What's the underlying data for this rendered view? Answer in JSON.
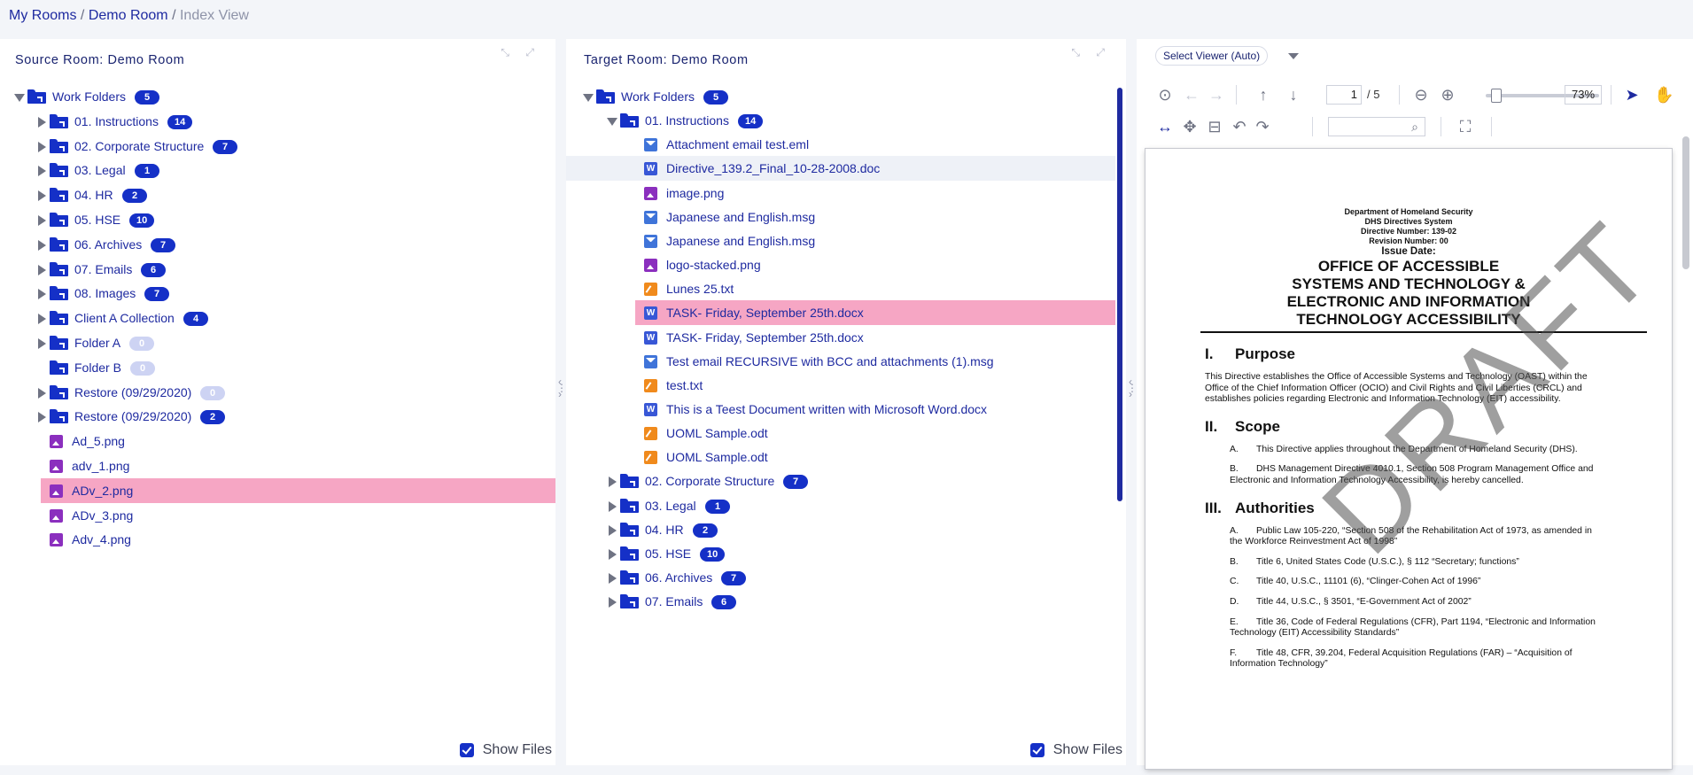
{
  "breadcrumb": {
    "root": "My Rooms",
    "sep1": "/",
    "room": "Demo Room",
    "sep2": "/",
    "current": "Index View"
  },
  "source": {
    "title": "Source Room: Demo Room",
    "show_files": "Show Files",
    "rows": [
      {
        "label": "Work Folders",
        "badge": "5",
        "kind": "folder",
        "toggle": "open"
      },
      {
        "label": "01. Instructions",
        "badge": "14",
        "kind": "folder",
        "toggle": "closed"
      },
      {
        "label": "02. Corporate Structure",
        "badge": "7",
        "kind": "folder",
        "toggle": "closed"
      },
      {
        "label": "03. Legal",
        "badge": "1",
        "kind": "folder",
        "toggle": "closed"
      },
      {
        "label": "04. HR",
        "badge": "2",
        "kind": "folder",
        "toggle": "closed"
      },
      {
        "label": "05. HSE",
        "badge": "10",
        "kind": "folder",
        "toggle": "closed"
      },
      {
        "label": "06. Archives",
        "badge": "7",
        "kind": "folder",
        "toggle": "closed"
      },
      {
        "label": "07. Emails",
        "badge": "6",
        "kind": "folder",
        "toggle": "closed"
      },
      {
        "label": "08. Images",
        "badge": "7",
        "kind": "folder",
        "toggle": "closed"
      },
      {
        "label": "Client A Collection",
        "badge": "4",
        "kind": "folder",
        "toggle": "closed"
      },
      {
        "label": "Folder A",
        "badge": "0",
        "kind": "folder",
        "toggle": "closed"
      },
      {
        "label": "Folder B",
        "badge": "0",
        "kind": "folder",
        "toggle": "none"
      },
      {
        "label": "Restore (09/29/2020)",
        "badge": "0",
        "kind": "folder",
        "toggle": "closed"
      },
      {
        "label": "Restore (09/29/2020)",
        "badge": "2",
        "kind": "folder",
        "toggle": "closed"
      },
      {
        "label": "Ad_5.png",
        "kind": "img"
      },
      {
        "label": "adv_1.png",
        "kind": "img"
      },
      {
        "label": "ADv_2.png",
        "kind": "img",
        "selected": true
      },
      {
        "label": "ADv_3.png",
        "kind": "img"
      },
      {
        "label": "Adv_4.png",
        "kind": "img"
      }
    ]
  },
  "target": {
    "title": "Target Room: Demo Room",
    "show_files": "Show Files",
    "rows": [
      {
        "label": "Work Folders",
        "badge": "5",
        "kind": "folder",
        "toggle": "open"
      },
      {
        "label": "01. Instructions",
        "badge": "14",
        "kind": "folder",
        "toggle": "open"
      },
      {
        "label": "Attachment email test.eml",
        "kind": "mail"
      },
      {
        "label": "Directive_139.2_Final_10-28-2008.doc",
        "kind": "doc",
        "hover": true
      },
      {
        "label": "image.png",
        "kind": "img"
      },
      {
        "label": "Japanese and English.msg",
        "kind": "mail"
      },
      {
        "label": "Japanese and English.msg",
        "kind": "mail"
      },
      {
        "label": "logo-stacked.png",
        "kind": "img"
      },
      {
        "label": "Lunes 25.txt",
        "kind": "txt"
      },
      {
        "label": "TASK- Friday, September 25th.docx",
        "kind": "doc",
        "selected": true
      },
      {
        "label": "TASK- Friday, September 25th.docx",
        "kind": "doc"
      },
      {
        "label": "Test email RECURSIVE with BCC and attachments (1).msg",
        "kind": "mail"
      },
      {
        "label": "test.txt",
        "kind": "txt"
      },
      {
        "label": "This is a Teest Document written with Microsoft Word.docx",
        "kind": "doc"
      },
      {
        "label": "UOML Sample.odt",
        "kind": "txt"
      },
      {
        "label": "UOML Sample.odt",
        "kind": "txt"
      },
      {
        "label": "02. Corporate Structure",
        "badge": "7",
        "kind": "folder",
        "toggle": "closed"
      },
      {
        "label": "03. Legal",
        "badge": "1",
        "kind": "folder",
        "toggle": "closed"
      },
      {
        "label": "04. HR",
        "badge": "2",
        "kind": "folder",
        "toggle": "closed"
      },
      {
        "label": "05. HSE",
        "badge": "10",
        "kind": "folder",
        "toggle": "closed"
      },
      {
        "label": "06. Archives",
        "badge": "7",
        "kind": "folder",
        "toggle": "closed"
      },
      {
        "label": "07. Emails",
        "badge": "6",
        "kind": "folder",
        "toggle": "closed"
      }
    ]
  },
  "viewer": {
    "select_label": "Select Viewer (Auto)",
    "page_current": "1",
    "page_total": "/ 5",
    "zoom": "73%",
    "zoom_slider_fraction": 0.05
  },
  "document": {
    "header": [
      "Department of Homeland Security",
      "DHS Directives System",
      "Directive Number: 139-02",
      "Revision Number: 00"
    ],
    "issue_date": "Issue Date:",
    "title_lines": [
      "OFFICE OF ACCESSIBLE",
      "SYSTEMS AND TECHNOLOGY &",
      "ELECTRONIC AND INFORMATION",
      "TECHNOLOGY ACCESSIBILITY"
    ],
    "s1_num": "I.",
    "s1_title": "Purpose",
    "s1_text": "This Directive establishes the Office of Accessible Systems and Technology (OAST) within the Office of the Chief Information Officer (OCIO) and Civil Rights and Civil Liberties (CRCL) and establishes policies regarding Electronic and Information Technology (EIT) accessibility.",
    "s2_num": "II.",
    "s2_title": "Scope",
    "s2_a": "This Directive applies throughout the Department of Homeland Security (DHS).",
    "s2_b": "DHS Management Directive 4010.1, Section 508 Program Management Office and Electronic and Information Technology Accessibility, is hereby cancelled.",
    "s3_num": "III.",
    "s3_title": "Authorities",
    "s3_items": [
      {
        "k": "A.",
        "t": "Public Law 105-220, “Section 508 of the Rehabilitation Act of 1973, as amended in the Workforce Reinvestment Act of 1998”"
      },
      {
        "k": "B.",
        "t": "Title 6, United States Code (U.S.C.), § 112 “Secretary; functions”"
      },
      {
        "k": "C.",
        "t": "Title 40, U.S.C., 11101 (6), “Clinger-Cohen Act of 1996”"
      },
      {
        "k": "D.",
        "t": "Title 44, U.S.C., § 3501, “E-Government Act of 2002”"
      },
      {
        "k": "E.",
        "t": "Title 36, Code of Federal Regulations (CFR), Part 1194, “Electronic and Information Technology (EIT) Accessibility Standards”"
      },
      {
        "k": "F.",
        "t": "Title 48, CFR, 39.204, Federal Acquisition Regulations (FAR) – “Acquisition of Information Technology”"
      }
    ],
    "watermark": "DRAFT"
  }
}
